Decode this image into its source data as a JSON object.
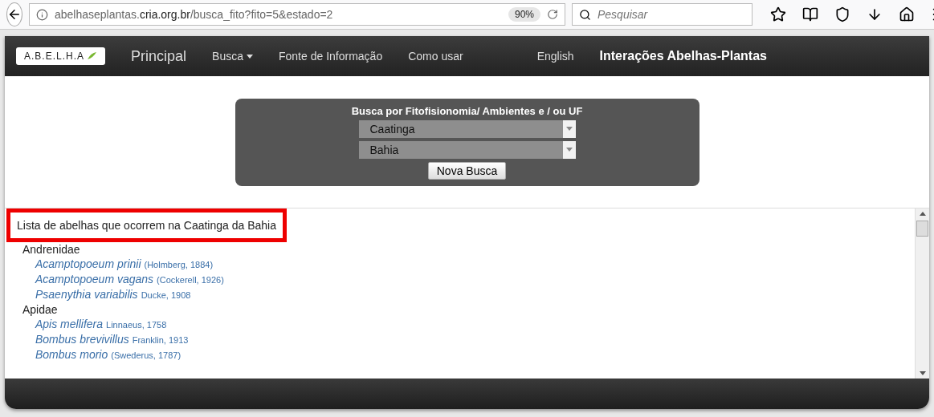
{
  "browser": {
    "url_prefix": "abelhaseplantas.",
    "url_domain": "cria.org.br",
    "url_path": "/busca_fito?fito=5&estado=2",
    "zoom": "90%",
    "search_placeholder": "Pesquisar"
  },
  "navbar": {
    "logo": "A.B.E.L.H.A",
    "items": [
      {
        "label": "Principal",
        "kind": "brand"
      },
      {
        "label": "Busca",
        "kind": "dropdown"
      },
      {
        "label": "Fonte de Informação",
        "kind": "link"
      },
      {
        "label": "Como usar",
        "kind": "link"
      },
      {
        "label": "English",
        "kind": "link"
      }
    ],
    "title": "Interações Abelhas-Plantas"
  },
  "search_panel": {
    "title": "Busca por Fitofisionomia/ Ambientes e / ou UF",
    "selects": [
      "Caatinga",
      "Bahia"
    ],
    "button": "Nova Busca"
  },
  "results": {
    "heading": "Lista de abelhas que ocorrem na Caatinga da Bahia",
    "highlighted": true,
    "families": [
      {
        "name": "Andrenidae",
        "species": [
          {
            "name": "Acamptopoeum prinii",
            "author": "(Holmberg, 1884)"
          },
          {
            "name": "Acamptopoeum vagans",
            "author": "(Cockerell, 1926)"
          },
          {
            "name": "Psaenythia variabilis",
            "author": "Ducke, 1908"
          }
        ]
      },
      {
        "name": "Apidae",
        "species": [
          {
            "name": "Apis mellifera",
            "author": "Linnaeus, 1758"
          },
          {
            "name": "Bombus brevivillus",
            "author": "Franklin, 1913"
          },
          {
            "name": "Bombus morio",
            "author": "(Swederus, 1787)"
          }
        ]
      }
    ]
  }
}
